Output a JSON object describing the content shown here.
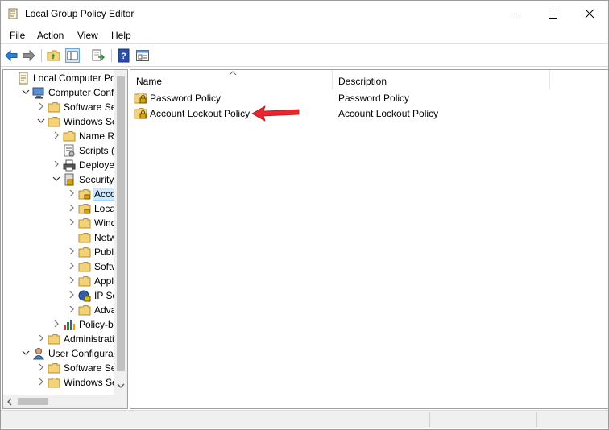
{
  "window": {
    "title": "Local Group Policy Editor",
    "icon": "policy-editor-icon"
  },
  "menu": [
    "File",
    "Action",
    "View",
    "Help"
  ],
  "toolbar": [
    "back-icon",
    "forward-icon",
    "up-folder-icon",
    "show-hide-tree-icon",
    "export-list-icon",
    "help-icon",
    "properties-pane-icon"
  ],
  "tree": [
    {
      "label": "Local Computer Polic",
      "icon": "policy-doc-icon",
      "expander": "none",
      "level": 0
    },
    {
      "label": "Computer Config",
      "icon": "computer-icon",
      "expander": "expanded",
      "level": 1
    },
    {
      "label": "Software Setti",
      "icon": "folder-icon",
      "expander": "collapsed",
      "level": 2
    },
    {
      "label": "Windows Setti",
      "icon": "folder-icon",
      "expander": "expanded",
      "level": 2
    },
    {
      "label": "Name Res",
      "icon": "folder-icon",
      "expander": "collapsed",
      "level": 3
    },
    {
      "label": "Scripts (Sta",
      "icon": "scripts-icon",
      "expander": "none",
      "level": 3
    },
    {
      "label": "Deployed",
      "icon": "printer-icon",
      "expander": "collapsed",
      "level": 3
    },
    {
      "label": "Security Se",
      "icon": "security-icon",
      "expander": "expanded",
      "level": 3
    },
    {
      "label": "Accou",
      "icon": "locked-folder-icon",
      "expander": "collapsed",
      "level": 4,
      "selected": true
    },
    {
      "label": "Local P",
      "icon": "locked-folder-icon",
      "expander": "collapsed",
      "level": 4
    },
    {
      "label": "Windo",
      "icon": "folder-icon",
      "expander": "collapsed",
      "level": 4
    },
    {
      "label": "Netwo",
      "icon": "folder-icon",
      "expander": "none",
      "level": 4
    },
    {
      "label": "Public",
      "icon": "folder-icon",
      "expander": "collapsed",
      "level": 4
    },
    {
      "label": "Softwa",
      "icon": "folder-icon",
      "expander": "collapsed",
      "level": 4
    },
    {
      "label": "Applic",
      "icon": "folder-icon",
      "expander": "collapsed",
      "level": 4
    },
    {
      "label": "IP Secu",
      "icon": "ip-security-icon",
      "expander": "collapsed",
      "level": 4
    },
    {
      "label": "Advan",
      "icon": "folder-icon",
      "expander": "collapsed",
      "level": 4
    },
    {
      "label": "Policy-bas",
      "icon": "chart-icon",
      "expander": "collapsed",
      "level": 3
    },
    {
      "label": "Administrative",
      "icon": "folder-icon",
      "expander": "collapsed",
      "level": 2
    },
    {
      "label": "User Configuration",
      "icon": "user-icon",
      "expander": "expanded",
      "level": 1
    },
    {
      "label": "Software Setti",
      "icon": "folder-icon",
      "expander": "collapsed",
      "level": 2
    },
    {
      "label": "Windows Sett",
      "icon": "folder-icon",
      "expander": "collapsed",
      "level": 2
    }
  ],
  "list": {
    "columns": [
      "Name",
      "Description"
    ],
    "rows": [
      {
        "name": "Password Policy",
        "description": "Password Policy",
        "icon": "locked-folder-icon"
      },
      {
        "name": "Account Lockout Policy",
        "description": "Account Lockout Policy",
        "icon": "locked-folder-icon"
      }
    ]
  },
  "colors": {
    "selection": "#cce8ff",
    "annotation_arrow": "#e8262d",
    "folder": "#f3d27a"
  }
}
